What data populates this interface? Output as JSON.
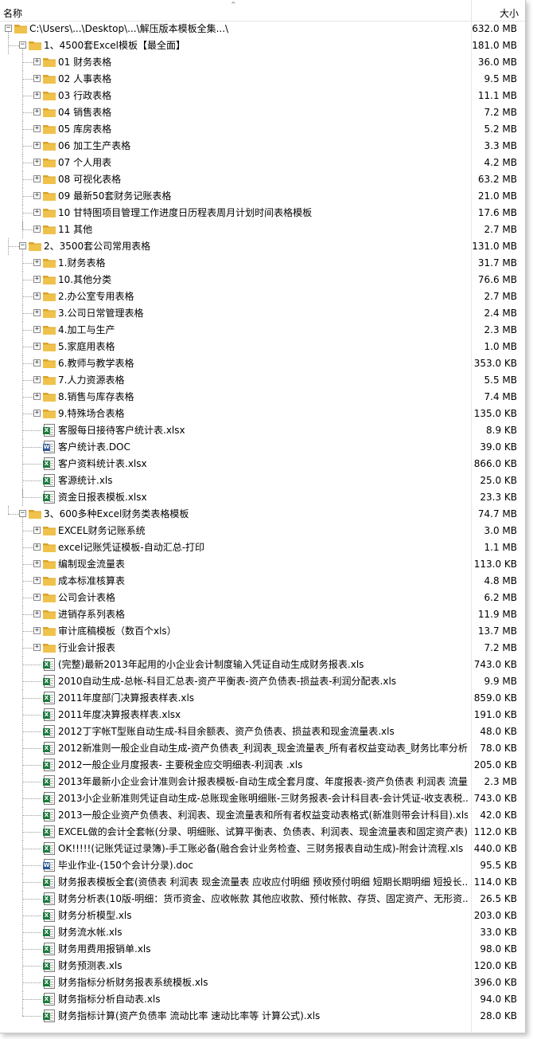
{
  "header": {
    "name_label": "名称",
    "size_label": "大小"
  },
  "colors": {
    "excel_icon": "#1d7a3e",
    "word_icon": "#2b579a",
    "folder": "#f0c24b",
    "folder_dark": "#d9a428"
  },
  "rows": [
    {
      "depth": 0,
      "type": "folder",
      "expanded": true,
      "name": "C:\\Users\\...\\Desktop\\...\\解压版本模板全集...\\",
      "size": "632.0 MB"
    },
    {
      "depth": 1,
      "type": "folder",
      "expanded": true,
      "name": "1、4500套Excel模板【最全面】",
      "size": "181.0 MB"
    },
    {
      "depth": 2,
      "type": "folder",
      "expanded": false,
      "name": "01 财务表格",
      "size": "36.0 MB"
    },
    {
      "depth": 2,
      "type": "folder",
      "expanded": false,
      "name": "02 人事表格",
      "size": "9.5 MB"
    },
    {
      "depth": 2,
      "type": "folder",
      "expanded": false,
      "name": "03 行政表格",
      "size": "11.1 MB"
    },
    {
      "depth": 2,
      "type": "folder",
      "expanded": false,
      "name": "04 销售表格",
      "size": "7.2 MB"
    },
    {
      "depth": 2,
      "type": "folder",
      "expanded": false,
      "name": "05 库房表格",
      "size": "5.2 MB"
    },
    {
      "depth": 2,
      "type": "folder",
      "expanded": false,
      "name": "06 加工生产表格",
      "size": "3.3 MB"
    },
    {
      "depth": 2,
      "type": "folder",
      "expanded": false,
      "name": "07 个人用表",
      "size": "4.2 MB"
    },
    {
      "depth": 2,
      "type": "folder",
      "expanded": false,
      "name": "08 可视化表格",
      "size": "63.2 MB"
    },
    {
      "depth": 2,
      "type": "folder",
      "expanded": false,
      "name": "09 最新50套财务记账表格",
      "size": "21.0 MB"
    },
    {
      "depth": 2,
      "type": "folder",
      "expanded": false,
      "name": "10 甘特图项目管理工作进度日历程表周月计划时间表格模板",
      "size": "17.6 MB"
    },
    {
      "depth": 2,
      "type": "folder",
      "expanded": false,
      "name": "11 其他",
      "size": "2.7 MB"
    },
    {
      "depth": 1,
      "type": "folder",
      "expanded": true,
      "name": "2、3500套公司常用表格",
      "size": "131.0 MB"
    },
    {
      "depth": 2,
      "type": "folder",
      "expanded": false,
      "name": "1.财务表格",
      "size": "31.7 MB"
    },
    {
      "depth": 2,
      "type": "folder",
      "expanded": false,
      "name": "10.其他分类",
      "size": "76.6 MB"
    },
    {
      "depth": 2,
      "type": "folder",
      "expanded": false,
      "name": "2.办公室专用表格",
      "size": "2.7 MB"
    },
    {
      "depth": 2,
      "type": "folder",
      "expanded": false,
      "name": "3.公司日常管理表格",
      "size": "2.4 MB"
    },
    {
      "depth": 2,
      "type": "folder",
      "expanded": false,
      "name": "4.加工与生产",
      "size": "2.3 MB"
    },
    {
      "depth": 2,
      "type": "folder",
      "expanded": false,
      "name": "5.家庭用表格",
      "size": "1.0 MB"
    },
    {
      "depth": 2,
      "type": "folder",
      "expanded": false,
      "name": "6.教师与教学表格",
      "size": "353.0 KB"
    },
    {
      "depth": 2,
      "type": "folder",
      "expanded": false,
      "name": "7.人力资源表格",
      "size": "5.5 MB"
    },
    {
      "depth": 2,
      "type": "folder",
      "expanded": false,
      "name": "8.销售与库存表格",
      "size": "7.4 MB"
    },
    {
      "depth": 2,
      "type": "folder",
      "expanded": false,
      "name": "9.特殊场合表格",
      "size": "135.0 KB"
    },
    {
      "depth": 2,
      "type": "xlsx",
      "name": "客服每日接待客户统计表.xlsx",
      "size": "8.9 KB"
    },
    {
      "depth": 2,
      "type": "doc",
      "name": "客户统计表.DOC",
      "size": "39.0 KB"
    },
    {
      "depth": 2,
      "type": "xlsx",
      "name": "客户资料统计表.xlsx",
      "size": "866.0 KB"
    },
    {
      "depth": 2,
      "type": "xls",
      "name": "客源统计.xls",
      "size": "25.0 KB"
    },
    {
      "depth": 2,
      "type": "xls",
      "name": "资金日报表模板.xlsx",
      "size": "23.3 KB"
    },
    {
      "depth": 1,
      "type": "folder",
      "expanded": true,
      "name": "3、600多种Excel财务类表格模板",
      "size": "74.7 MB"
    },
    {
      "depth": 2,
      "type": "folder",
      "expanded": false,
      "name": "EXCEL财务记账系统",
      "size": "3.0 MB"
    },
    {
      "depth": 2,
      "type": "folder",
      "expanded": false,
      "name": "excel记账凭证模板-自动汇总-打印",
      "size": "1.1 MB"
    },
    {
      "depth": 2,
      "type": "folder",
      "expanded": false,
      "name": "编制现金流量表",
      "size": "113.0 KB"
    },
    {
      "depth": 2,
      "type": "folder",
      "expanded": false,
      "name": "成本标准核算表",
      "size": "4.8 MB"
    },
    {
      "depth": 2,
      "type": "folder",
      "expanded": false,
      "name": "公司会计表格",
      "size": "6.2 MB"
    },
    {
      "depth": 2,
      "type": "folder",
      "expanded": false,
      "name": "进销存系列表格",
      "size": "11.9 MB"
    },
    {
      "depth": 2,
      "type": "folder",
      "expanded": false,
      "name": "审计底稿模板（数百个xls）",
      "size": "13.7 MB"
    },
    {
      "depth": 2,
      "type": "folder",
      "expanded": false,
      "name": "行业会计报表",
      "size": "7.2 MB"
    },
    {
      "depth": 2,
      "type": "xls",
      "name": "(完整)最新2013年起用的小企业会计制度输入凭证自动生成财务报表.xls",
      "size": "743.0 KB"
    },
    {
      "depth": 2,
      "type": "xls",
      "name": "2010自动生成-总帐-科目汇总表-资产平衡表-资产负债表-损益表-利润分配表.xls",
      "size": "9.9 MB"
    },
    {
      "depth": 2,
      "type": "xls",
      "name": "2011年度部门决算报表样表.xls",
      "size": "859.0 KB"
    },
    {
      "depth": 2,
      "type": "xlsx",
      "name": "2011年度决算报表样表.xlsx",
      "size": "191.0 KB"
    },
    {
      "depth": 2,
      "type": "xls",
      "name": "2012丁字帐T型账自动生成-科目余额表、资产负债表、损益表和现金流量表.xls",
      "size": "48.0 KB"
    },
    {
      "depth": 2,
      "type": "xls",
      "name": "2012新准则一般企业自动生成-资产负债表_利润表_现金流量表_所有者权益变动表_财务比率分析...",
      "size": "78.0 KB"
    },
    {
      "depth": 2,
      "type": "xls",
      "name": "2012一般企业月度报表- 主要税金应交明细表-利润表 .xls",
      "size": "205.0 KB"
    },
    {
      "depth": 2,
      "type": "xls",
      "name": "2013年最新小企业会计准则会计报表模板-自动生成全套月度、年度报表-资产负债表 利润表 流量...",
      "size": "2.3 MB"
    },
    {
      "depth": 2,
      "type": "xls",
      "name": "2013小企业新准则凭证自动生成-总账现金账明细账-三财务报表-会计科目表-会计凭证-收支表税...",
      "size": "743.0 KB"
    },
    {
      "depth": 2,
      "type": "xls",
      "name": "2013一般企业资产负债表、利润表、现金流量表和所有者权益变动表格式(新准则带会计科目).xls",
      "size": "42.0 KB"
    },
    {
      "depth": 2,
      "type": "xls",
      "name": "EXCEL做的会计全套帐(分录、明细账、试算平衡表、负债表、利润表、现金流量表和固定资产表)...",
      "size": "112.0 KB"
    },
    {
      "depth": 2,
      "type": "xls",
      "name": "OK!!!!!(记账凭证过录簿)-手工账必备(融合会计业务检查、三财务报表自动生成)-附会计流程.xls",
      "size": "440.0 KB"
    },
    {
      "depth": 2,
      "type": "doc",
      "name": "毕业作业-(150个会计分录).doc",
      "size": "95.5 KB"
    },
    {
      "depth": 2,
      "type": "xls",
      "name": "财务报表模板全套(资债表 利润表 现金流量表 应收应付明细 预收预付明细 短期长期明细 短投长...",
      "size": "114.0 KB"
    },
    {
      "depth": 2,
      "type": "xls",
      "name": "财务分析表(10版-明细：货币资金、应收帐款 其他应收款、预付帐款、存货、固定资产、无形资...",
      "size": "26.5 KB"
    },
    {
      "depth": 2,
      "type": "xls",
      "name": "财务分析模型.xls",
      "size": "203.0 KB"
    },
    {
      "depth": 2,
      "type": "xls",
      "name": "财务流水帐.xls",
      "size": "33.0 KB"
    },
    {
      "depth": 2,
      "type": "xls",
      "name": "财务用费用报销单.xls",
      "size": "98.0 KB"
    },
    {
      "depth": 2,
      "type": "xls",
      "name": "财务预测表.xls",
      "size": "120.0 KB"
    },
    {
      "depth": 2,
      "type": "xls",
      "name": "财务指标分析财务报表系统模板.xls",
      "size": "396.0 KB"
    },
    {
      "depth": 2,
      "type": "xls",
      "name": "财务指标分析自动表.xls",
      "size": "94.0 KB"
    },
    {
      "depth": 2,
      "type": "xls",
      "name": "财务指标计算(资产负债率 流动比率 速动比率等 计算公式).xls",
      "size": "28.0 KB"
    }
  ]
}
